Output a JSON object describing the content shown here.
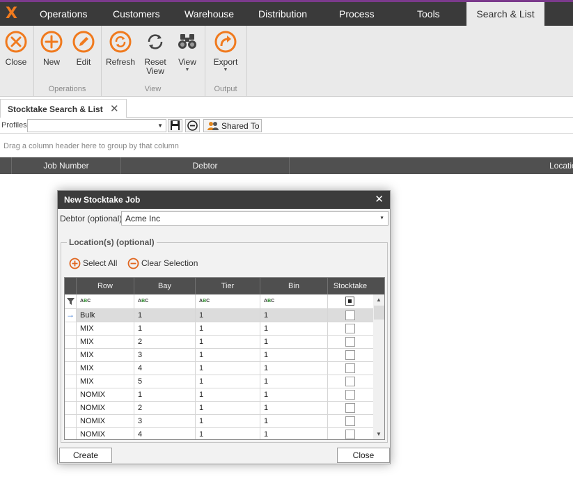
{
  "app": {
    "menu": [
      {
        "label": "Operations"
      },
      {
        "label": "Customers"
      },
      {
        "label": "Warehouse"
      },
      {
        "label": "Distribution"
      },
      {
        "label": "Process"
      },
      {
        "label": "Tools"
      },
      {
        "label": "Search & List",
        "active": true
      }
    ]
  },
  "ribbon": {
    "buttons": {
      "close": "Close",
      "new": "New",
      "edit": "Edit",
      "refresh": "Refresh",
      "reset_view": "Reset\nView",
      "view": "View",
      "export": "Export"
    },
    "groups": {
      "operations": "Operations",
      "view": "View",
      "output": "Output"
    }
  },
  "document_tab": {
    "title": "Stocktake Search & List"
  },
  "profiles": {
    "label": "Profiles",
    "value": "",
    "shared_to": "Shared To"
  },
  "grid": {
    "group_hint": "Drag a column header here to group by that column",
    "columns": [
      "Job Number",
      "Debtor",
      "Location"
    ]
  },
  "dialog": {
    "title": "New Stocktake Job",
    "debtor_label": "Debtor (optional)",
    "debtor_value": "Acme Inc",
    "locations_legend": "Location(s) (optional)",
    "select_all": "Select All",
    "clear_selection": "Clear Selection",
    "columns": [
      "Row",
      "Bay",
      "Tier",
      "Bin",
      "Stocktake"
    ],
    "filter_glyph": "ABC",
    "rows": [
      {
        "row": "Bulk",
        "bay": "1",
        "tier": "1",
        "bin": "1",
        "stocktake": false
      },
      {
        "row": "MIX",
        "bay": "1",
        "tier": "1",
        "bin": "1",
        "stocktake": false
      },
      {
        "row": "MIX",
        "bay": "2",
        "tier": "1",
        "bin": "1",
        "stocktake": false
      },
      {
        "row": "MIX",
        "bay": "3",
        "tier": "1",
        "bin": "1",
        "stocktake": false
      },
      {
        "row": "MIX",
        "bay": "4",
        "tier": "1",
        "bin": "1",
        "stocktake": false
      },
      {
        "row": "MIX",
        "bay": "5",
        "tier": "1",
        "bin": "1",
        "stocktake": false
      },
      {
        "row": "NOMIX",
        "bay": "1",
        "tier": "1",
        "bin": "1",
        "stocktake": false
      },
      {
        "row": "NOMIX",
        "bay": "2",
        "tier": "1",
        "bin": "1",
        "stocktake": false
      },
      {
        "row": "NOMIX",
        "bay": "3",
        "tier": "1",
        "bin": "1",
        "stocktake": false
      },
      {
        "row": "NOMIX",
        "bay": "4",
        "tier": "1",
        "bin": "1",
        "stocktake": false
      }
    ],
    "create_button": "Create",
    "close_button": "Close"
  },
  "colors": {
    "accent_orange": "#f07a1e",
    "menu_bar": "#3a3a3a",
    "brand_purple": "#7b3a8c",
    "grid_header": "#505050"
  },
  "icons": [
    "close-icon",
    "add-icon",
    "edit-icon",
    "refresh-icon",
    "reset-view-icon",
    "binoculars-icon",
    "export-icon",
    "save-icon",
    "remove-icon",
    "users-icon",
    "filter-icon",
    "row-indicator-arrow-icon"
  ]
}
